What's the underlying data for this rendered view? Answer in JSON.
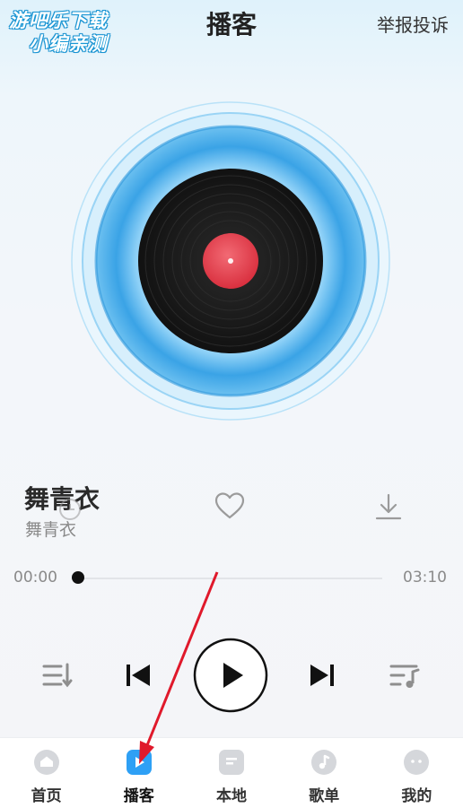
{
  "watermark": {
    "line1": "游吧乐下载",
    "line2": "小编亲测"
  },
  "header": {
    "title": "播客",
    "report_label": "举报投诉"
  },
  "song": {
    "title": "舞青衣",
    "artist": "舞青衣"
  },
  "progress": {
    "current": "00:00",
    "total": "03:10",
    "fraction": 0.0
  },
  "tabs": [
    {
      "label": "首页",
      "icon": "home-icon"
    },
    {
      "label": "播客",
      "icon": "podcast-play-icon"
    },
    {
      "label": "本地",
      "icon": "local-file-icon"
    },
    {
      "label": "歌单",
      "icon": "music-note-icon"
    },
    {
      "label": "我的",
      "icon": "profile-face-icon"
    }
  ],
  "active_tab": "播客",
  "colors": {
    "accent": "#2ea0f5",
    "disc_ring": "#56b6ee",
    "record_label": "#e64553",
    "annotation_arrow": "#e0192b"
  }
}
